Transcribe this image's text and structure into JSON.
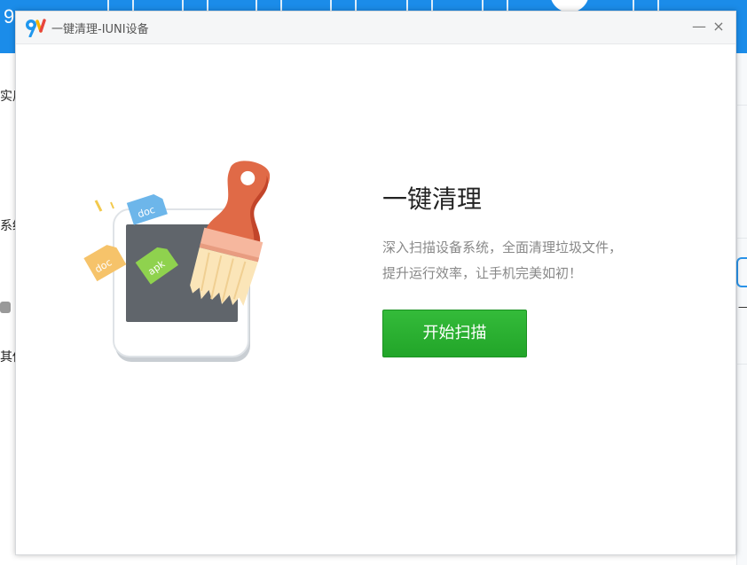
{
  "background_app": {
    "logo_text": "9",
    "sidebar_items": [
      "实用",
      "系统",
      "其他"
    ],
    "right_edge_text": "一"
  },
  "dialog": {
    "title": "一键清理-IUNI设备",
    "minimize_glyph": "—",
    "close_glyph": "×",
    "heading": "一键清理",
    "description_line1": "深入扫描设备系统，全面清理垃圾文件，",
    "description_line2": "提升运行效率，让手机完美如初！",
    "scan_button_label": "开始扫描",
    "illustration_labels": {
      "doc_blue": "doc",
      "doc_orange": "doc",
      "apk_green": "apk"
    }
  },
  "colors": {
    "topbar": "#1b8ce9",
    "scan_button": "#28ab2e",
    "brush_handle": "#e06a47"
  }
}
